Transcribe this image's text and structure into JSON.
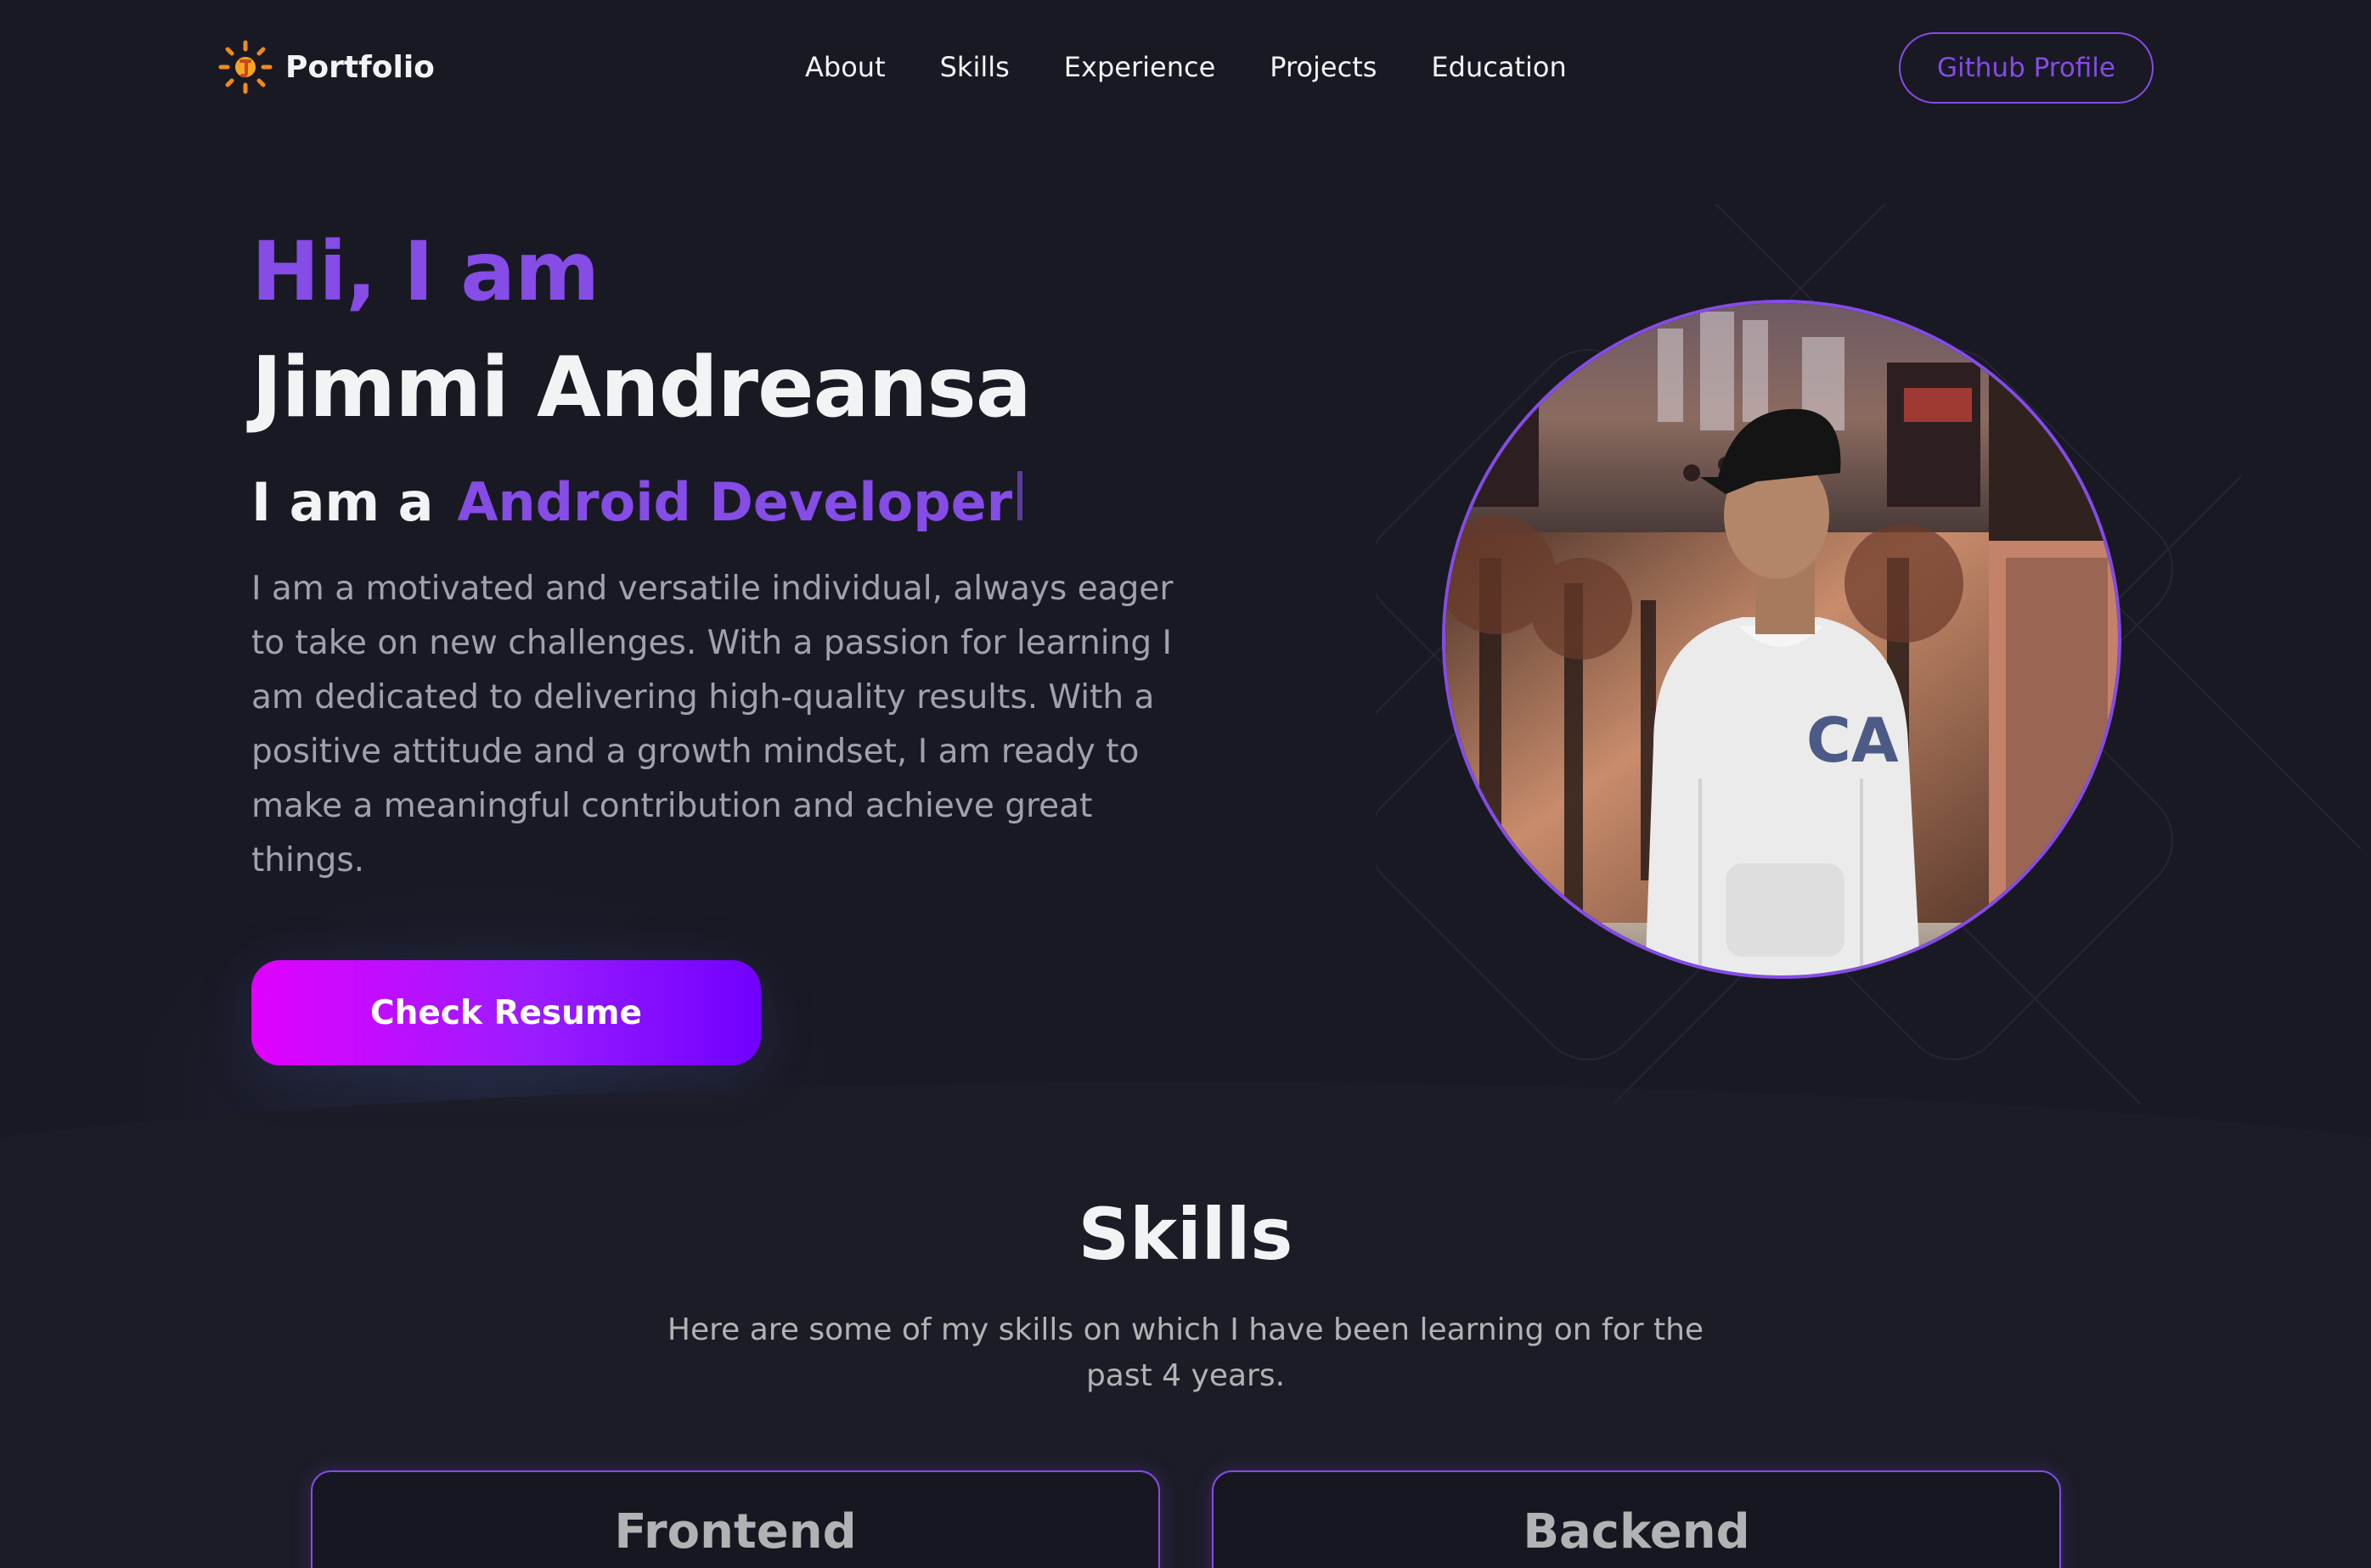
{
  "nav": {
    "brand": "Portfolio",
    "links": [
      "About",
      "Skills",
      "Experience",
      "Projects",
      "Education"
    ],
    "github_label": "Github Profile"
  },
  "hero": {
    "greeting": "Hi, I am",
    "name": "Jimmi Andreansa",
    "role_prefix": "I am a",
    "role_value": "Android Developer",
    "bio": "I am a motivated and versatile individual, always eager to take on new challenges. With a passion for learning I am dedicated to delivering high-quality results. With a positive attitude and a growth mindset, I am ready to make a meaningful contribution and achieve great things.",
    "resume_label": "Check Resume",
    "hoodie_text": "CA"
  },
  "skills": {
    "title": "Skills",
    "desc_line1": "Here are some of my skills on which I have been learning on for the",
    "desc_line2": "past 4 years.",
    "cards": [
      "Frontend",
      "Backend"
    ]
  },
  "colors": {
    "background": "#1c1c27",
    "nav_background": "#191924",
    "primary": "#854ce6",
    "text_primary": "#f2f3f4",
    "text_secondary": "#b1b2b3",
    "button_gradient_start": "#e100ff",
    "button_gradient_end": "#7000ff"
  },
  "icons": {
    "logo": "sun-logo-icon"
  }
}
